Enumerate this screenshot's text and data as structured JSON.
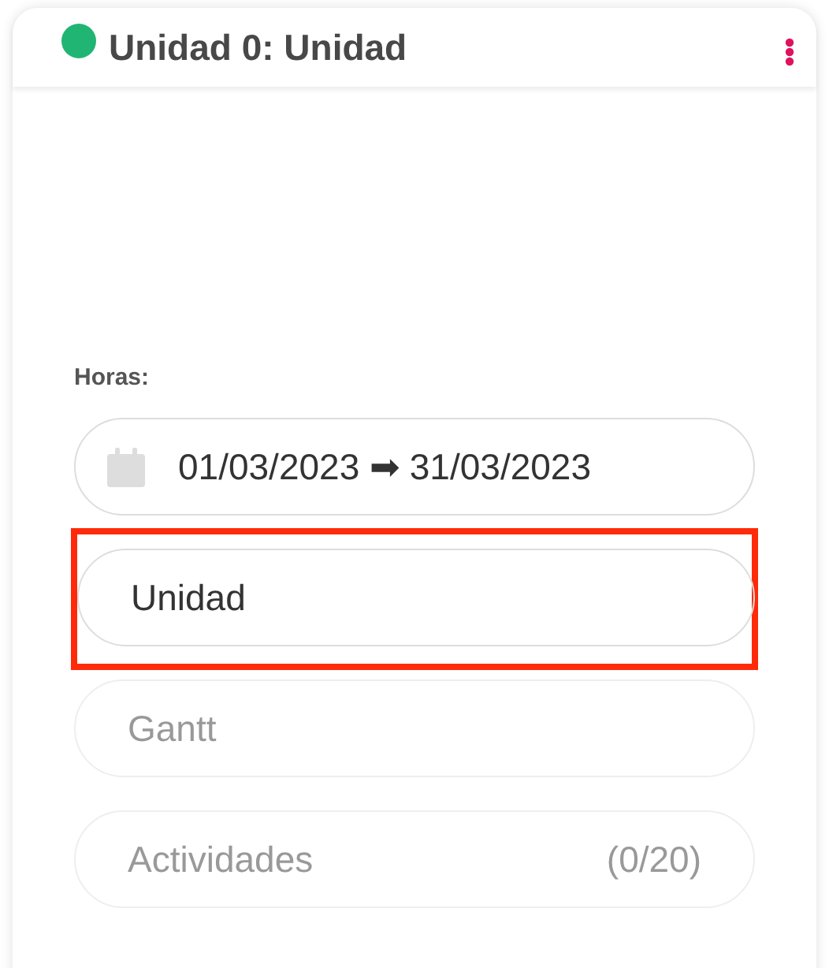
{
  "card": {
    "title": "Unidad 0: Unidad"
  },
  "section_label": "Horas:",
  "rows": [
    {
      "kind": "date",
      "text": "01/03/2023 ➡ 31/03/2023",
      "disabled": false,
      "highlighted": false
    },
    {
      "kind": "text",
      "text": "Unidad",
      "disabled": false,
      "highlighted": true
    },
    {
      "kind": "text",
      "text": "Gantt",
      "disabled": true,
      "highlighted": false
    },
    {
      "kind": "count",
      "text": "Actividades",
      "count": "(0/20)",
      "disabled": true,
      "highlighted": false
    }
  ]
}
